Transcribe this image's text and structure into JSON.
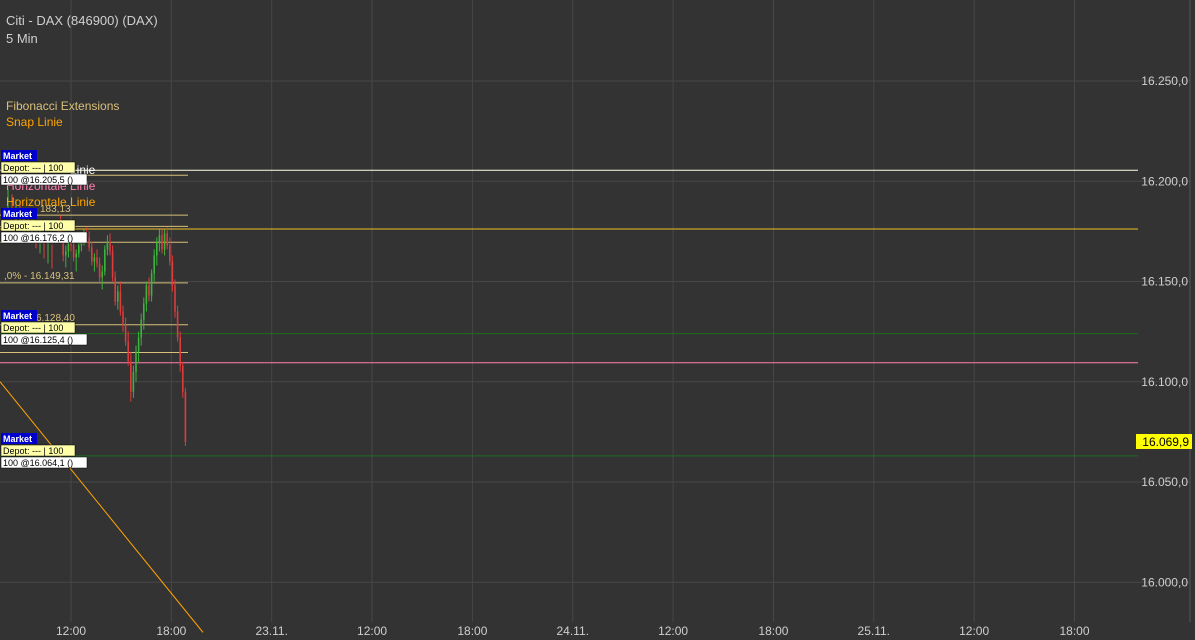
{
  "window": {
    "title": "Citi - DAX (846900) (DAX)",
    "interval": "5 Min"
  },
  "legend": [
    {
      "label": "Fibonacci Extensions",
      "color": "#d8c07a"
    },
    {
      "label": "Snap Linie",
      "color": "#ffa500"
    }
  ],
  "overlay_labels": {
    "horizontal_line_white": "Linie",
    "horizontal_line_pink": "Horizontale Linie",
    "horizontal_line_orange": "Horizontale Linie",
    "fib_label_top": "183,13",
    "fib_label_mid": ",0% - 16.149,31",
    "fib_label_low": "6.128,40"
  },
  "orders": [
    {
      "type": "Market",
      "depot": "Depot: --- | 100",
      "order": "100 @16.205,5 ()"
    },
    {
      "type": "Market",
      "depot": "Depot: --- | 100",
      "order": "100 @16.176,2 ()"
    },
    {
      "type": "Market",
      "depot": "Depot: --- | 100",
      "order": "100 @16.125,4 ()"
    },
    {
      "type": "Market",
      "depot": "Depot: --- | 100",
      "order": "100 @16.064,1 ()"
    }
  ],
  "price_axis": {
    "current_price": "16.069,9"
  },
  "colors": {
    "background": "#333333",
    "grid": "#474747",
    "up_candle": "#3cb43c",
    "down_candle": "#dc3c3c",
    "price_badge": "#ffff00",
    "order_market": "#0000cc",
    "order_depot": "#ffffaa"
  },
  "chart_data": {
    "type": "candlestick",
    "y_ticks": [
      "16.250,0",
      "16.200,0",
      "16.150,0",
      "16.100,0",
      "16.050,0",
      "16.000,0"
    ],
    "y_tick_values": [
      16250,
      16200,
      16150,
      16100,
      16050,
      16000
    ],
    "x_ticks": [
      "12:00",
      "18:00",
      "23.11.",
      "12:00",
      "18:00",
      "24.11.",
      "12:00",
      "18:00",
      "25.11.",
      "12:00",
      "18:00"
    ],
    "ylim": [
      15975,
      16290
    ],
    "grid": true,
    "horizontal_lines": [
      {
        "value": 16205.5,
        "color": "#ffffe0"
      },
      {
        "value": 16176.2,
        "color": "#e8c020"
      },
      {
        "value": 16124.0,
        "color": "#1e6e1e"
      },
      {
        "value": 16109.5,
        "color": "#ff7fb0"
      },
      {
        "value": 16063.0,
        "color": "#1e6e1e"
      }
    ],
    "short_lines": [
      {
        "value": 16203.0,
        "color": "#d8c07a"
      },
      {
        "value": 16183.1,
        "color": "#d8c07a"
      },
      {
        "value": 16177.5,
        "color": "#d8c07a"
      },
      {
        "value": 16169.6,
        "color": "#d8c07a"
      },
      {
        "value": 16149.3,
        "color": "#d8c07a"
      },
      {
        "value": 16128.4,
        "color": "#d8c07a"
      },
      {
        "value": 16114.6,
        "color": "#d8c07a"
      }
    ],
    "trendline": {
      "from": [
        0,
        16100
      ],
      "to": [
        203,
        15975
      ],
      "color": "#ffa500"
    },
    "candles": [
      [
        16175,
        16180,
        16172,
        16178
      ],
      [
        16178,
        16183,
        16170,
        16172
      ],
      [
        16172,
        16175,
        16160,
        16163
      ],
      [
        16163,
        16168,
        16157,
        16165
      ],
      [
        16165,
        16172,
        16162,
        16170
      ],
      [
        16170,
        16174,
        16165,
        16168
      ],
      [
        16168,
        16171,
        16160,
        16162
      ],
      [
        16162,
        16166,
        16155,
        16164
      ],
      [
        16164,
        16170,
        16162,
        16168
      ],
      [
        16168,
        16173,
        16165,
        16171
      ],
      [
        16171,
        16176,
        16168,
        16174
      ],
      [
        16174,
        16177,
        16169,
        16172
      ],
      [
        16172,
        16175,
        16165,
        16167
      ],
      [
        16167,
        16170,
        16158,
        16160
      ],
      [
        16160,
        16164,
        16155,
        16162
      ],
      [
        16162,
        16166,
        16157,
        16159
      ],
      [
        16159,
        16162,
        16150,
        16152
      ],
      [
        16152,
        16158,
        16146,
        16155
      ],
      [
        16155,
        16168,
        16153,
        16166
      ],
      [
        16166,
        16173,
        16163,
        16170
      ],
      [
        16170,
        16174,
        16163,
        16165
      ],
      [
        16165,
        16168,
        16150,
        16152
      ],
      [
        16152,
        16155,
        16138,
        16140
      ],
      [
        16140,
        16148,
        16136,
        16145
      ],
      [
        16145,
        16150,
        16133,
        16135
      ],
      [
        16135,
        16138,
        16125,
        16128
      ],
      [
        16128,
        16132,
        16118,
        16120
      ],
      [
        16120,
        16125,
        16108,
        16110
      ],
      [
        16110,
        16115,
        16090,
        16095
      ],
      [
        16095,
        16108,
        16092,
        16105
      ],
      [
        16105,
        16118,
        16100,
        16115
      ],
      [
        16115,
        16125,
        16110,
        16122
      ],
      [
        16122,
        16134,
        16118,
        16131
      ],
      [
        16131,
        16142,
        16126,
        16139
      ],
      [
        16139,
        16150,
        16135,
        16148
      ],
      [
        16148,
        16152,
        16140,
        16143
      ],
      [
        16143,
        16156,
        16140,
        16154
      ],
      [
        16154,
        16166,
        16150,
        16163
      ],
      [
        16163,
        16172,
        16158,
        16170
      ],
      [
        16170,
        16176,
        16165,
        16173
      ],
      [
        16173,
        16176,
        16164,
        16166
      ],
      [
        16166,
        16176,
        16163,
        16174
      ],
      [
        16174,
        16177,
        16166,
        16168
      ],
      [
        16168,
        16172,
        16158,
        16160
      ],
      [
        16160,
        16163,
        16145,
        16148
      ],
      [
        16148,
        16151,
        16132,
        16135
      ],
      [
        16135,
        16138,
        16120,
        16122
      ],
      [
        16122,
        16125,
        16105,
        16108
      ],
      [
        16108,
        16110,
        16092,
        16095
      ],
      [
        16095,
        16097,
        16068,
        16070
      ]
    ]
  }
}
